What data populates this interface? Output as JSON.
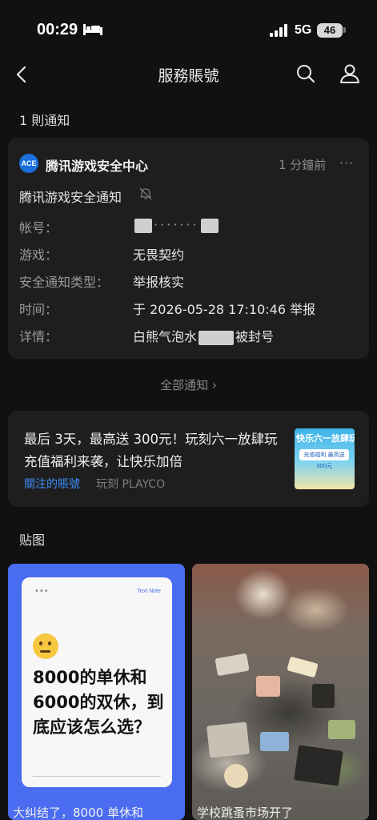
{
  "status_bar": {
    "time": "00:29",
    "network": "5G",
    "battery": "46"
  },
  "nav": {
    "title": "服務賬號"
  },
  "notifications_header": "1 則通知",
  "notice": {
    "sender": "腾讯游戏安全中心",
    "time_ago": "1 分鐘前",
    "more": "···",
    "title": "腾讯游戏安全通知",
    "rows": [
      {
        "key": "帐号：",
        "value": ""
      },
      {
        "key": "游戏：",
        "value": "无畏契约"
      },
      {
        "key": "安全通知类型：",
        "value": "举报核实"
      },
      {
        "key": "时间：",
        "value": "于 2026-05-28 17:10:46 举报"
      },
      {
        "key": "详情：",
        "value_prefix": "白熊气泡水",
        "value_suffix": "被封号"
      }
    ]
  },
  "all_notices_link": "全部通知 ›",
  "ad": {
    "text": "最后 3天，最高送 300元！玩刻六一放肆玩充值福利来袭，让快乐加倍",
    "follow_label": "關注的賬號",
    "source": "玩刻 PLAYCO",
    "thumb_title": "快乐六一放肆玩",
    "thumb_sub": "充值福利 最高送300元"
  },
  "posts_header": "贴图",
  "posts": [
    {
      "card_tag": "Text Note",
      "card_dots": "•••",
      "headline": "8000的单休和6000的双休，到底应该怎么选？",
      "caption": "大纠结了，8000 单休和"
    },
    {
      "caption": "学校跳蚤市场开了"
    }
  ],
  "colors": {
    "background": "#111111",
    "card": "#1e1e1e",
    "link_blue": "#3d8ef7",
    "post_blue": "#4a6cf0"
  }
}
